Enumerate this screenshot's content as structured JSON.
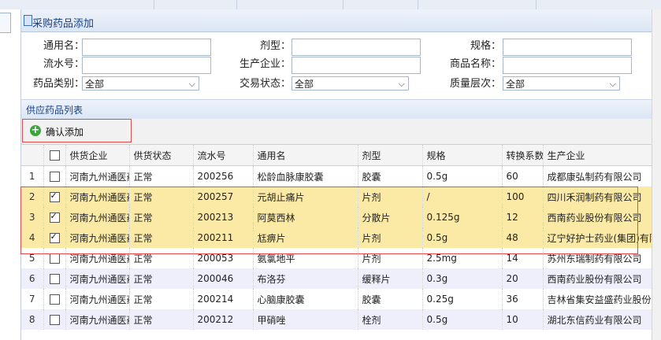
{
  "panel": {
    "title": "采购药品添加"
  },
  "filters": {
    "generic_name": {
      "label": "通用名：",
      "value": ""
    },
    "dosage_form": {
      "label": "剂型：",
      "value": ""
    },
    "spec": {
      "label": "规格：",
      "value": ""
    },
    "serial_no": {
      "label": "流水号：",
      "value": ""
    },
    "manufacturer": {
      "label": "生产企业：",
      "value": ""
    },
    "product_name": {
      "label": "商品名称：",
      "value": ""
    },
    "drug_category": {
      "label": "药品类别：",
      "selected": "全部"
    },
    "trade_status": {
      "label": "交易状态：",
      "selected": "全部"
    },
    "quality_level": {
      "label": "质量层次：",
      "selected": "全部"
    }
  },
  "grid": {
    "title": "供应药品列表",
    "confirm_add_label": "确认添加",
    "columns": [
      "供货企业",
      "供货状态",
      "流水号",
      "通用名",
      "剂型",
      "规格",
      "转换系数",
      "生产企业"
    ],
    "rows": [
      {
        "num": "1",
        "checked": false,
        "supplier": "河南九州通医药",
        "status": "正常",
        "serial": "200256",
        "name": "松龄血脉康胶囊",
        "form": "胶囊",
        "spec": "0.5g",
        "factor": "60",
        "maker": "成都康弘制药有限公司"
      },
      {
        "num": "2",
        "checked": true,
        "supplier": "河南九州通医药",
        "status": "正常",
        "serial": "200257",
        "name": "元胡止痛片",
        "form": "片剂",
        "spec": "/",
        "factor": "100",
        "maker": "四川禾润制药有限公司"
      },
      {
        "num": "3",
        "checked": true,
        "supplier": "河南九州通医药",
        "status": "正常",
        "serial": "200213",
        "name": "阿莫西林",
        "form": "分散片",
        "spec": "0.125g",
        "factor": "12",
        "maker": "西南药业股份有限公司"
      },
      {
        "num": "4",
        "checked": true,
        "supplier": "河南九州通医药",
        "status": "正常",
        "serial": "200211",
        "name": "尪痹片",
        "form": "片剂",
        "spec": "0.5g",
        "factor": "48",
        "maker": "辽宁好护士药业(集团)有限责任公司"
      },
      {
        "num": "5",
        "checked": false,
        "supplier": "河南九州通医药",
        "status": "正常",
        "serial": "200053",
        "name": "氨氯地平",
        "form": "片剂",
        "spec": "2.5mg",
        "factor": "14",
        "maker": "苏州东瑞制药有限公司"
      },
      {
        "num": "6",
        "checked": false,
        "supplier": "河南九州通医药",
        "status": "正常",
        "serial": "200046",
        "name": "布洛芬",
        "form": "缓释片",
        "spec": "0.3g",
        "factor": "20",
        "maker": "西南药业股份有限公司"
      },
      {
        "num": "7",
        "checked": false,
        "supplier": "河南九州通医药",
        "status": "正常",
        "serial": "200214",
        "name": "心脑康胶囊",
        "form": "胶囊",
        "spec": "0.25g",
        "factor": "36",
        "maker": "吉林省集安益盛药业股份有限公司"
      },
      {
        "num": "8",
        "checked": false,
        "supplier": "河南九州通医药",
        "status": "正常",
        "serial": "200212",
        "name": "甲硝唑",
        "form": "栓剂",
        "spec": "0.5g",
        "factor": "10",
        "maker": "湖北东信药业有限公司"
      }
    ]
  }
}
